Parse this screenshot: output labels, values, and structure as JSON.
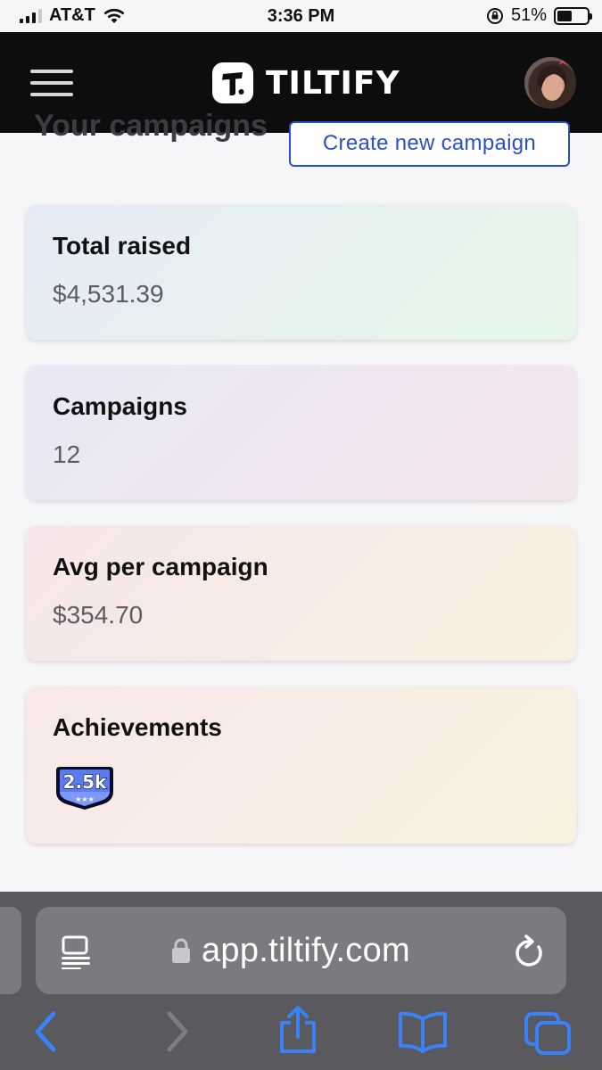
{
  "status_bar": {
    "carrier": "AT&T",
    "time": "3:36 PM",
    "battery_percent": "51%",
    "battery_level": 0.51
  },
  "header": {
    "brand": "TILTIFY"
  },
  "page": {
    "heading": "Your campaigns",
    "create_button": "Create new campaign"
  },
  "stats": {
    "total_raised": {
      "label": "Total raised",
      "value": "$4,531.39"
    },
    "campaigns": {
      "label": "Campaigns",
      "value": "12"
    },
    "avg_per_campaign": {
      "label": "Avg per campaign",
      "value": "$354.70"
    },
    "achievements": {
      "label": "Achievements",
      "badge_text": "2.5k"
    }
  },
  "browser": {
    "url": "app.tiltify.com"
  },
  "icons": {
    "menu": "hamburger-menu-icon",
    "reader": "reader-mode-icon",
    "lock": "lock-icon",
    "reload": "reload-icon",
    "back": "back-chevron-icon",
    "forward": "forward-chevron-icon",
    "share": "share-icon",
    "bookmarks": "bookmarks-icon",
    "tabs": "tabs-icon"
  },
  "colors": {
    "accent": "#2b4fc9",
    "header_bg": "#0d0d0d",
    "safari_blue": "#3a82f7"
  }
}
